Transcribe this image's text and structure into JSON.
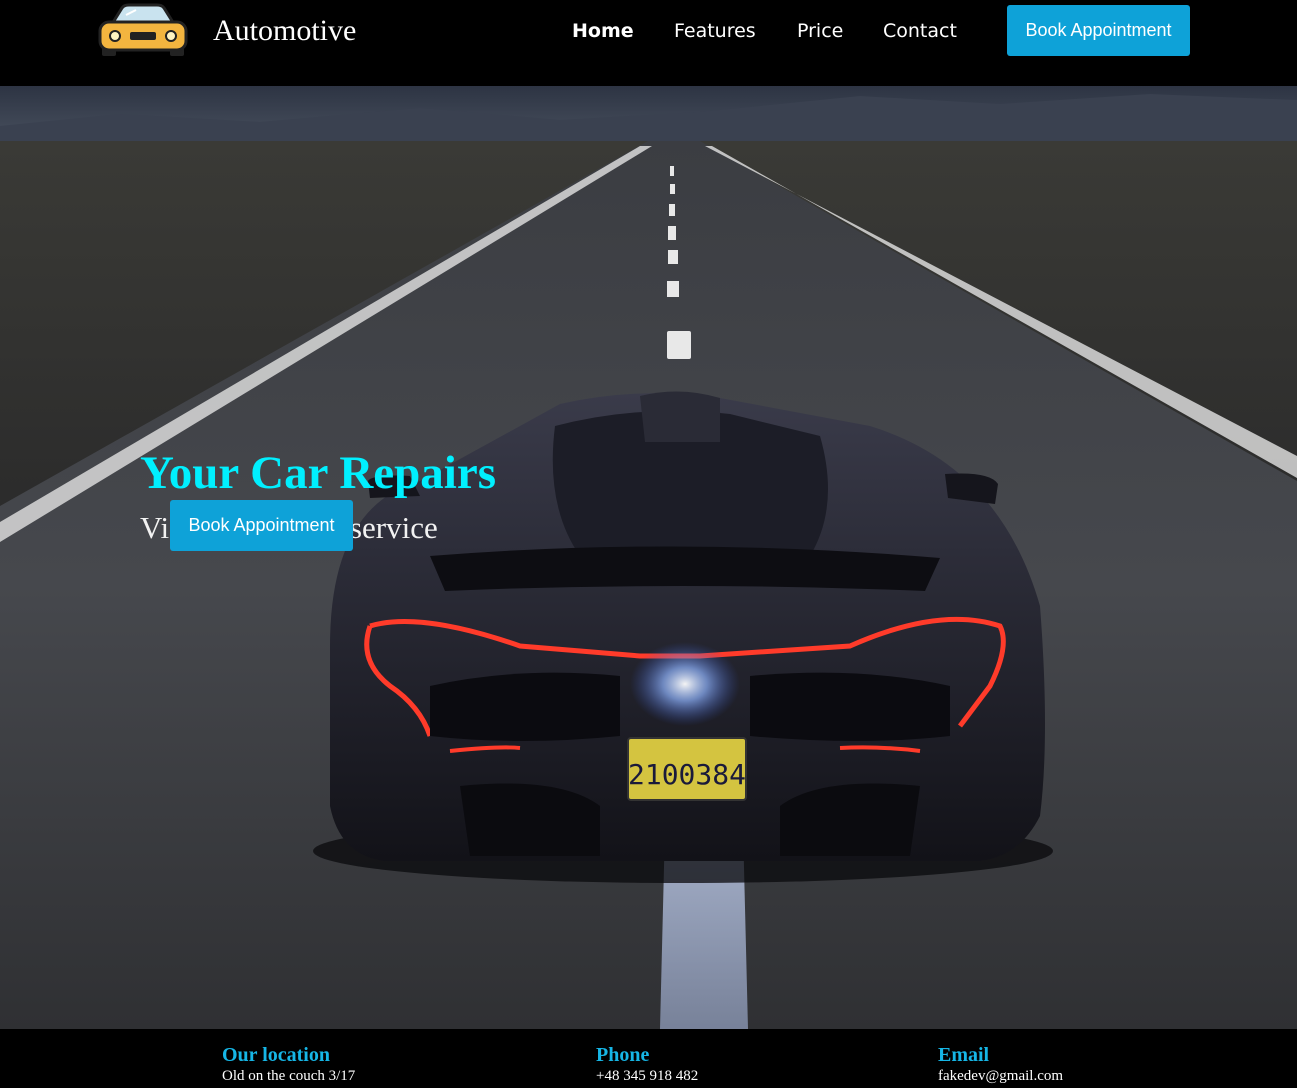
{
  "header": {
    "brand": "Automotive",
    "logo_icon": "car-front-icon",
    "nav": {
      "home": "Home",
      "features": "Features",
      "price": "Price",
      "contact": "Contact"
    },
    "book_button": "Book Appointment"
  },
  "hero": {
    "title": "Your Car Repairs",
    "subtitle": "Visit us for your service",
    "book_button": "Book Appointment",
    "image_alt": "sports-car-on-highway-image",
    "license_plate": "2100384"
  },
  "footer": {
    "location": {
      "heading": "Our location",
      "value": "Old on the couch 3/17"
    },
    "phone": {
      "heading": "Phone",
      "value": "+48 345 918 482"
    },
    "email": {
      "heading": "Email",
      "value": "fakedev@gmail.com"
    }
  },
  "colors": {
    "accent": "#0ea2d8",
    "hero_title": "#00f0ff",
    "footer_heading": "#16b6e6",
    "background": "#000000"
  }
}
